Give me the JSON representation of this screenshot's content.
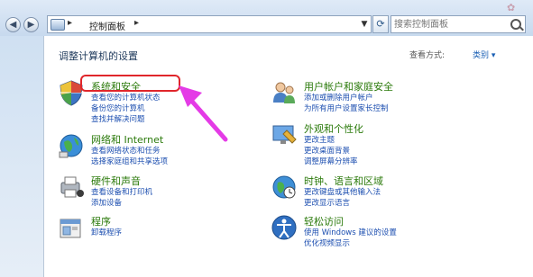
{
  "window": {
    "breadcrumb": "控制面板",
    "search_placeholder": "搜索控制面板"
  },
  "content": {
    "heading": "调整计算机的设置",
    "view_by_label": "查看方式:",
    "view_by_value": "类别 ▾"
  },
  "categories": {
    "system_security": {
      "title": "系统和安全",
      "links": [
        "查看您的计算机状态",
        "备份您的计算机",
        "查找并解决问题"
      ]
    },
    "network": {
      "title": "网络和 Internet",
      "links": [
        "查看网络状态和任务",
        "选择家庭组和共享选项"
      ]
    },
    "hardware": {
      "title": "硬件和声音",
      "links": [
        "查看设备和打印机",
        "添加设备"
      ]
    },
    "programs": {
      "title": "程序",
      "links": [
        "卸载程序"
      ]
    },
    "user_accounts": {
      "title": "用户帐户和家庭安全",
      "links": [
        "添加或删除用户帐户",
        "为所有用户设置家长控制"
      ]
    },
    "appearance": {
      "title": "外观和个性化",
      "links": [
        "更改主题",
        "更改桌面背景",
        "调整屏幕分辨率"
      ]
    },
    "clock": {
      "title": "时钟、语言和区域",
      "links": [
        "更改键盘或其他输入法",
        "更改显示语言"
      ]
    },
    "ease": {
      "title": "轻松访问",
      "links": [
        "使用 Windows 建议的设置",
        "优化视频显示"
      ]
    }
  },
  "colors": {
    "annotation": "#e0262b",
    "arrow": "#e43be6",
    "link": "#1d4fb0",
    "category_title": "#2b7a0b"
  }
}
